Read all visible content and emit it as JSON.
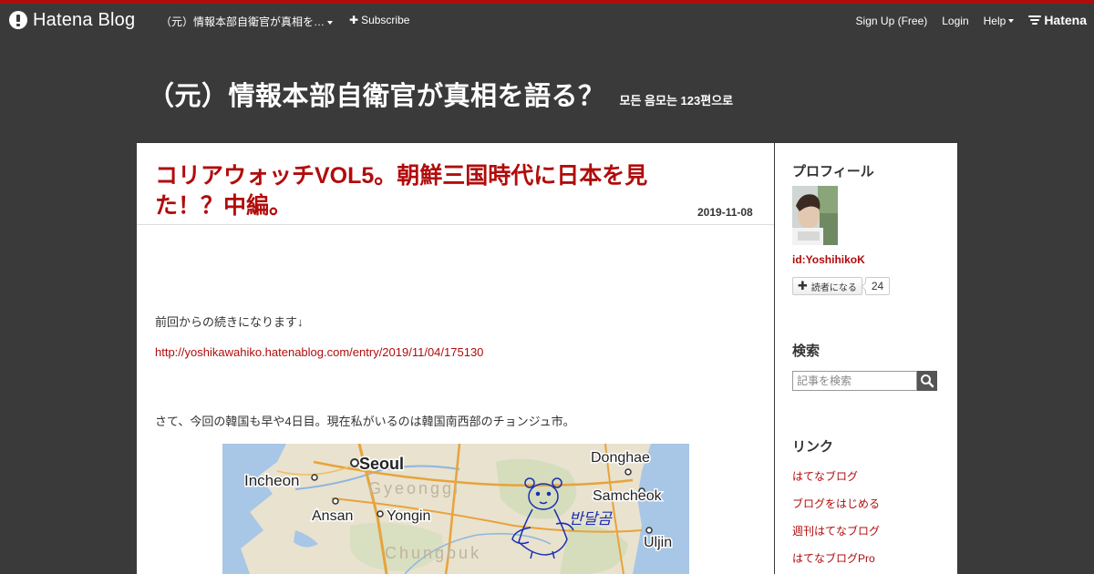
{
  "global_header": {
    "logo_text": "Hatena Blog",
    "blog_switcher_label": "（元）情報本部自衛官が真相を…",
    "subscribe_label": "Subscribe",
    "signup_label": "Sign Up (Free)",
    "login_label": "Login",
    "help_label": "Help",
    "hatena_label": "Hatena"
  },
  "blog": {
    "title": "（元）情報本部自衛官が真相を語る？",
    "description": "모든 음모는 123편으로"
  },
  "entry": {
    "title": "コリアウォッチVOL5。朝鮮三国時代に日本を見た！？中編。",
    "date": "2019-11-08",
    "paragraph1": "前回からの続きになります↓",
    "link_text": "http://yoshikawahiko.hatenablog.com/entry/2019/11/04/175130",
    "paragraph2": "さて、今回の韓国も早や4日目。現在私がいるのは韓国南西部のチョンジュ市。"
  },
  "map": {
    "labels": {
      "seoul": "Seoul",
      "incheon": "Incheon",
      "gyeonggi": "Gyeonggi",
      "ansan": "Ansan",
      "yongin": "Yongin",
      "chungbuk": "Chungbuk",
      "donghae": "Donghae",
      "samcheok": "Samcheok",
      "uljin": "Uljin",
      "handwriting": "반달곰"
    }
  },
  "sidebar": {
    "profile_heading": "プロフィール",
    "profile_id": "id:YoshihikoK",
    "subscribe_button": "読者になる",
    "subscriber_count": "24",
    "search_heading": "検索",
    "search_placeholder": "記事を検索",
    "links_heading": "リンク",
    "links": [
      "はてなブログ",
      "ブログをはじめる",
      "週刊はてなブログ",
      "はてなブログPro"
    ]
  },
  "colors": {
    "accent": "#b10c0c",
    "header_bg": "#3a3a3a",
    "link": "#b10c0c"
  }
}
